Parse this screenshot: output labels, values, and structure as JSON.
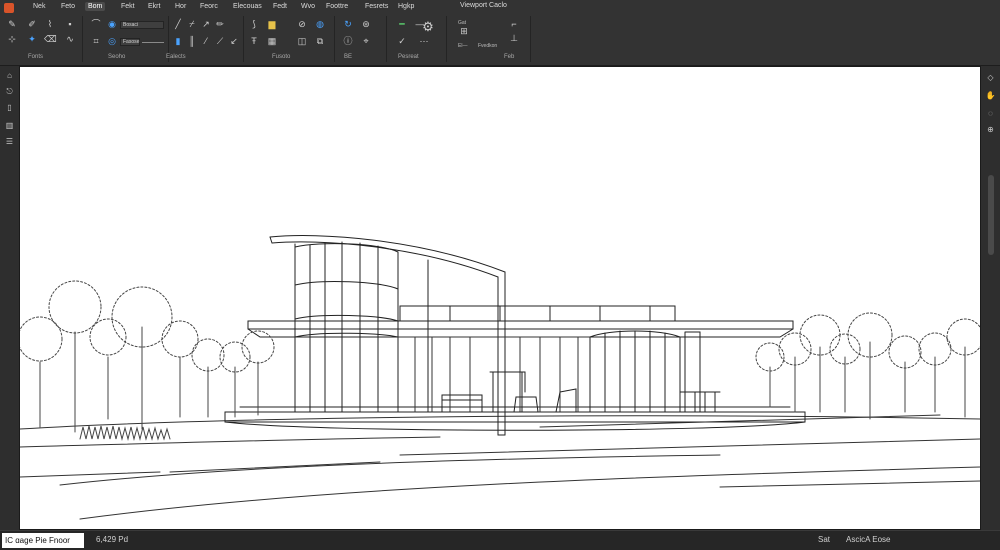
{
  "app": {
    "logo_icon": "app-logo-icon"
  },
  "menu": {
    "items": [
      "Nek",
      "Feto",
      "Bom",
      "Fekt",
      "Ekrt",
      "Hor",
      "Feorc",
      "Elecouas",
      "Fedt",
      "Wvo",
      "Foottre",
      "Fesrets",
      "Hgkp"
    ],
    "active_index": 2,
    "viewport_title": "Viewport Caclo"
  },
  "ribbon": {
    "fields": {
      "field_a": "Bosaci",
      "field_b": "Fasose"
    },
    "labels": {
      "gat": "Gat",
      "lower_left": "El—",
      "lower_right": "Fvedkon"
    },
    "panels": [
      "Fonts",
      "Seoho",
      "Ealects",
      "Fusoto",
      "BE",
      "Pesreat",
      "Feb"
    ]
  },
  "left_toolbar": {
    "icons": [
      "select-icon",
      "paint-icon",
      "layer-icon",
      "grid-icon",
      "list-icon"
    ]
  },
  "right_toolbar": {
    "icons": [
      "layers-icon",
      "pan-icon",
      "orbit-icon",
      "zoom-icon"
    ]
  },
  "status": {
    "mode": "IC ɑage Pie Fnoor",
    "coords": "6,429 Pd",
    "snap_label": "Sat",
    "zoom_label": "AscicA Eose"
  },
  "colors": {
    "accent": "#4aa3ff",
    "highlight": "#e6c24a",
    "confirm": "#58c46a",
    "logo": "#d9542a"
  }
}
